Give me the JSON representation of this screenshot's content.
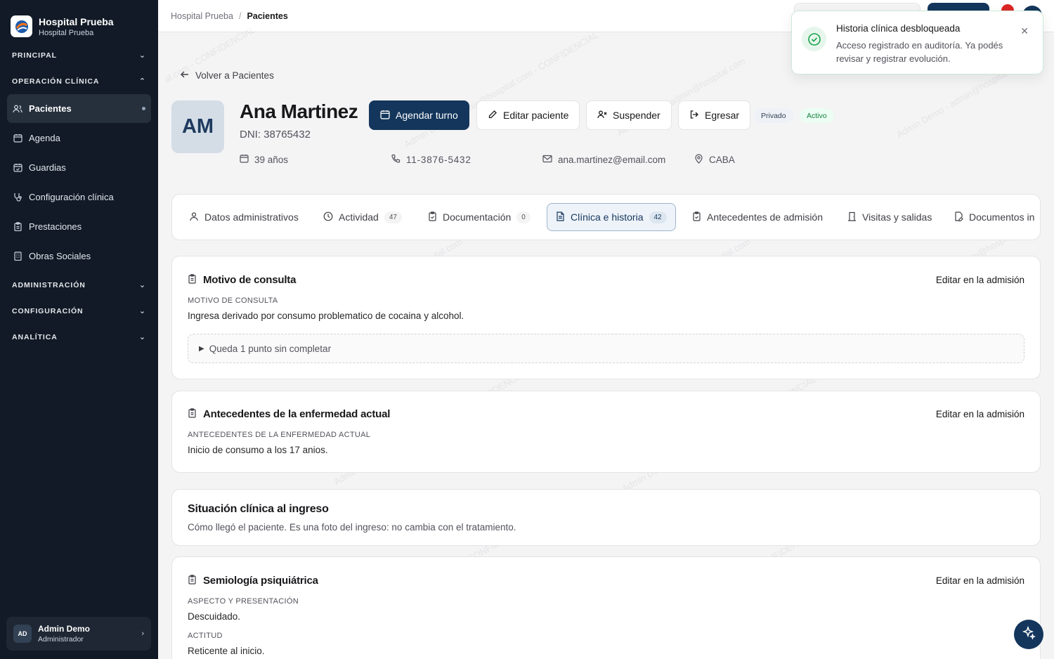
{
  "brand": {
    "title": "Hospital Prueba",
    "subtitle": "Hospital Prueba"
  },
  "sidebar": {
    "sections": [
      {
        "label": "PRINCIPAL"
      },
      {
        "label": "OPERACIÓN CLÍNICA"
      },
      {
        "label": "ADMINISTRACIÓN"
      },
      {
        "label": "CONFIGURACIÓN"
      },
      {
        "label": "ANALÍTICA"
      }
    ],
    "items": [
      {
        "label": "Pacientes",
        "icon": "users-icon"
      },
      {
        "label": "Agenda",
        "icon": "calendar-icon"
      },
      {
        "label": "Guardias",
        "icon": "calendar-check-icon"
      },
      {
        "label": "Configuración clínica",
        "icon": "stethoscope-icon"
      },
      {
        "label": "Prestaciones",
        "icon": "clipboard-icon"
      },
      {
        "label": "Obras Sociales",
        "icon": "building-icon"
      }
    ],
    "user": {
      "initials": "AD",
      "name": "Admin Demo",
      "role": "Administrador"
    }
  },
  "breadcrumb": {
    "root": "Hospital Prueba",
    "current": "Pacientes"
  },
  "back": {
    "label": "Volver a Pacientes"
  },
  "patient": {
    "initials": "AM",
    "name": "Ana Martinez",
    "dni": "DNI: 38765432",
    "age": "39 años",
    "phone": "11-3876-5432",
    "email": "ana.martinez@email.com",
    "location": "CABA",
    "tag_coverage": "Privado",
    "tag_status": "Activo"
  },
  "actions": {
    "schedule": "Agendar turno",
    "edit": "Editar paciente",
    "suspend": "Suspender",
    "discharge": "Egresar"
  },
  "tabs": [
    {
      "label": "Datos administrativos",
      "count": ""
    },
    {
      "label": "Actividad",
      "count": "47"
    },
    {
      "label": "Documentación",
      "count": "0"
    },
    {
      "label": "Clínica e historia",
      "count": "42"
    },
    {
      "label": "Antecedentes de admisión",
      "count": ""
    },
    {
      "label": "Visitas y salidas",
      "count": ""
    },
    {
      "label": "Documentos in",
      "count": ""
    }
  ],
  "cards": {
    "motivo": {
      "title": "Motivo de consulta",
      "link": "Editar en la admisión",
      "field_label": "MOTIVO DE CONSULTA",
      "field_value": "Ingresa derivado por consumo problematico de cocaina y alcohol.",
      "pending": "Queda 1 punto sin completar"
    },
    "antecedentes": {
      "title": "Antecedentes de la enfermedad actual",
      "link": "Editar en la admisión",
      "field_label": "ANTECEDENTES DE LA ENFERMEDAD ACTUAL",
      "field_value": "Inicio de consumo a los 17 anios."
    },
    "situacion": {
      "title": "Situación clínica al ingreso",
      "description": "Cómo llegó el paciente. Es una foto del ingreso: no cambia con el tratamiento."
    },
    "semiologia": {
      "title": "Semiología psiquiátrica",
      "link": "Editar en la admisión",
      "field1_label": "ASPECTO Y PRESENTACIÓN",
      "field1_value": "Descuidado.",
      "field2_label": "ACTITUD",
      "field2_value": "Reticente al inicio."
    }
  },
  "toast": {
    "title": "Historia clínica desbloqueada",
    "message": "Acceso registrado en auditoría. Ya podés revisar y registrar evolución."
  },
  "colors": {
    "primary": "#14365c",
    "sidebar": "#111a26",
    "success": "#16a34a"
  }
}
